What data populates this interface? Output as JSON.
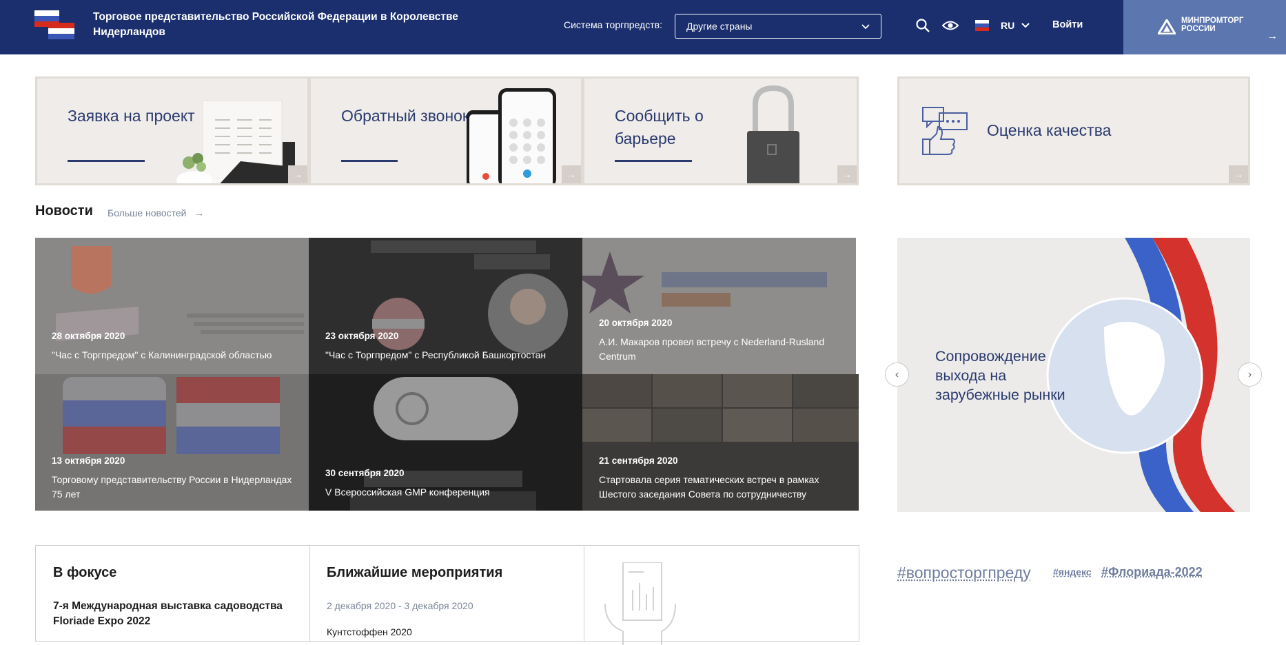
{
  "header": {
    "site_title": "Торговое представительство Российской Федерации в Королевстве Нидерландов",
    "system_label": "Система торгпредств:",
    "system_select_value": "Другие страны",
    "lang": "RU",
    "login": "Войти",
    "ministry": "МИНПРОМТОРГ РОССИИ",
    "colors": {
      "bar": "#1b2f6e",
      "ministry_box": "#5c76b0"
    }
  },
  "service_cards": [
    {
      "title": "Заявка на проект",
      "icon": "documents-plant-image"
    },
    {
      "title": "Обратный звонок",
      "icon": "smartphones-image"
    },
    {
      "title": "Сообщить о барьере",
      "icon": "padlock-image"
    },
    {
      "title": "Оценка качества",
      "icon": "chat-thumbs-up-icon"
    }
  ],
  "news": {
    "title": "Новости",
    "more": "Больше новостей",
    "items": [
      {
        "date": "28 октября 2020",
        "text": "\"Час с Торгпредом\" с Калининградской областью"
      },
      {
        "date": "23 октября 2020",
        "text": "\"Час с Торгпредом\" с Республикой Башкортостан"
      },
      {
        "date": "20 октября 2020",
        "text": "А.И. Макаров провел встречу с Nederland-Rusland Centrum"
      },
      {
        "date": "13 октября 2020",
        "text": "Торговому представительству России в Нидерландах 75 лет"
      },
      {
        "date": "30 сентября 2020",
        "text": "V Всероссийская GMP конференция"
      },
      {
        "date": "21 сентября 2020",
        "text": "Стартовала серия тематических встреч в рамках Шестого заседания Совета по сотрудничеству"
      }
    ]
  },
  "banner": {
    "text": "Сопровождение выхода на зарубежные рынки"
  },
  "focus": {
    "title": "В фокусе",
    "item": "7-я Международная выставка садоводства Floriade Expo 2022"
  },
  "events": {
    "title": "Ближайшие мероприятия",
    "date": "2 декабря 2020 - 3 декабря 2020",
    "name": "Кунтстоффен 2020"
  },
  "tags": [
    "#вопросторгпреду",
    "#яндекс",
    "#Флориада-2022"
  ]
}
